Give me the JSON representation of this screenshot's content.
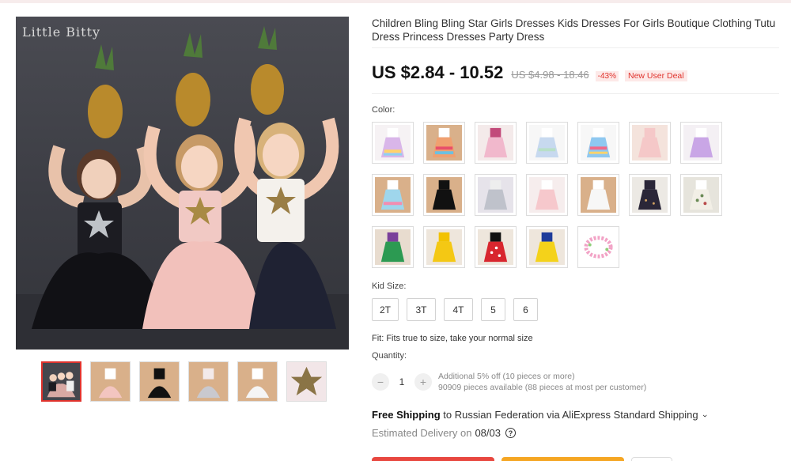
{
  "gallery": {
    "brand_watermark": "Little Bitty",
    "thumbnail_count": 6
  },
  "product": {
    "title": "Children Bling Bling Star Girls Dresses Kids Dresses For Girls Boutique Clothing Tutu Dress Princess Dresses Party Dress",
    "price": "US $2.84 - 10.52",
    "original_price": "US $4.98 - 18.46",
    "discount": "-43%",
    "deal_badge": "New User Deal"
  },
  "color": {
    "label": "Color:",
    "option_count": 19
  },
  "size": {
    "label": "Kid Size:",
    "options": [
      "2T",
      "3T",
      "4T",
      "5",
      "6"
    ]
  },
  "fit_text": "Fit: Fits true to size, take your normal size",
  "quantity": {
    "label": "Quantity:",
    "minus": "−",
    "plus": "+",
    "value": "1",
    "discount_note": "Additional 5% off (10 pieces or more)",
    "availability": "90909 pieces available (88 pieces at most per customer)"
  },
  "shipping": {
    "free_label": "Free Shipping",
    "destination": " to Russian Federation via AliExpress Standard Shipping",
    "chevron": "›",
    "estimated_label": "Estimated Delivery on",
    "date": "08/03",
    "help": "?"
  },
  "colors": {
    "price_red": "#e0332d",
    "buy_now": "#e8473f",
    "add_to_cart": "#f5a623"
  }
}
